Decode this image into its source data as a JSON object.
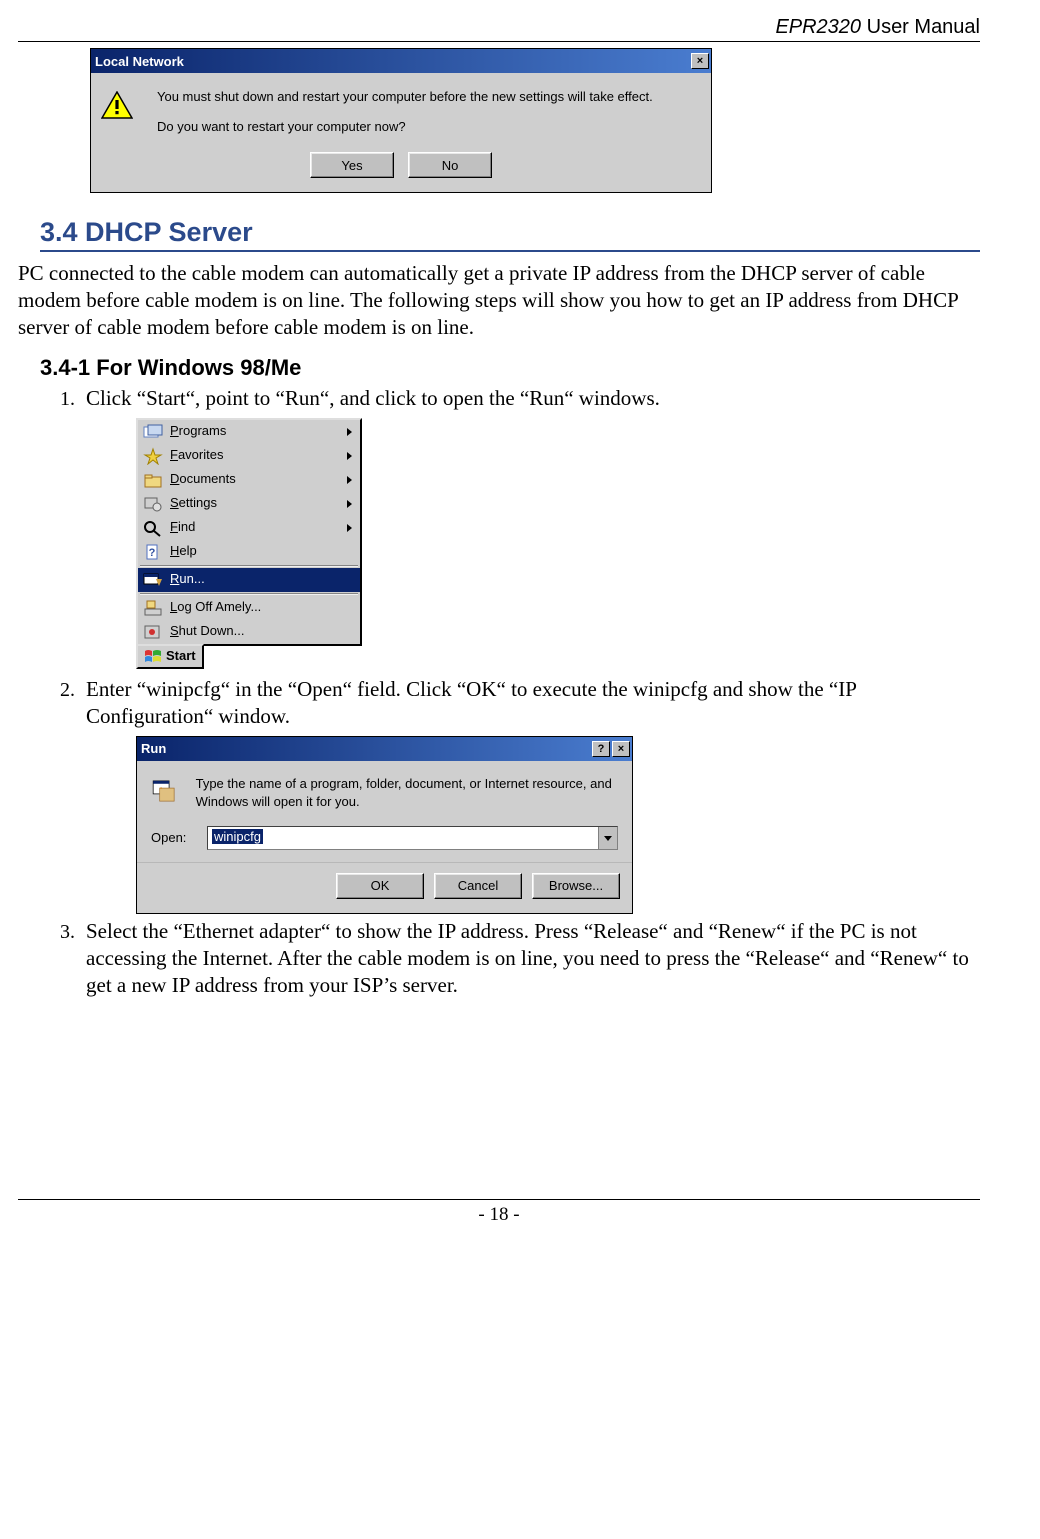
{
  "header": {
    "product": "EPR2320",
    "suffix": " User Manual"
  },
  "footer": {
    "page": "- 18 -"
  },
  "dialog1": {
    "title": "Local Network",
    "line1": "You must shut down and restart your computer before the new settings will take effect.",
    "line2": "Do you want to restart your computer now?",
    "yes": "Yes",
    "no": "No",
    "close": "×"
  },
  "section": {
    "num_title": "3.4 DHCP Server"
  },
  "intro_para": "PC connected to the cable modem can automatically get a private IP address from the DHCP server of cable modem before cable modem is on line. The following steps will show you how to get an IP address from DHCP server of cable modem before cable modem is on line.",
  "subsec": {
    "title": "3.4-1 For Windows 98/Me"
  },
  "steps": {
    "s1": "Click “Start“, point to “Run“, and click to open the “Run“ windows.",
    "s2": "Enter “winipcfg“ in the “Open“ field. Click “OK“ to execute the winipcfg and show the “IP Configuration“ window.",
    "s3": "Select the “Ethernet adapter“ to show the IP address. Press “Release“ and “Renew“ if the PC is not accessing the Internet. After the cable modem is on line, you need to press the “Release“ and “Renew“ to get a new IP address from your ISP’s server."
  },
  "startmenu": {
    "items": [
      {
        "u": "P",
        "rest": "rograms",
        "arrow": true
      },
      {
        "u": "F",
        "rest": "avorites",
        "arrow": true
      },
      {
        "u": "D",
        "rest": "ocuments",
        "arrow": true
      },
      {
        "u": "S",
        "rest": "ettings",
        "arrow": true
      },
      {
        "u": "F",
        "rest": "ind",
        "arrow": true
      },
      {
        "u": "H",
        "rest": "elp",
        "arrow": false
      },
      {
        "u": "R",
        "rest": "un...",
        "arrow": false,
        "selected": true
      },
      {
        "u": "L",
        "rest": "og Off Amely...",
        "arrow": false
      },
      {
        "u": "S",
        "rest": "hut Down...",
        "arrow": false
      }
    ],
    "start_label": "Start"
  },
  "rundlg": {
    "title": "Run",
    "help": "?",
    "close": "×",
    "desc": "Type the name of a program, folder, document, or Internet resource, and Windows will open it for you.",
    "open_label": "Open:",
    "open_value": "winipcfg",
    "ok": "OK",
    "cancel": "Cancel",
    "browse": "Browse..."
  }
}
